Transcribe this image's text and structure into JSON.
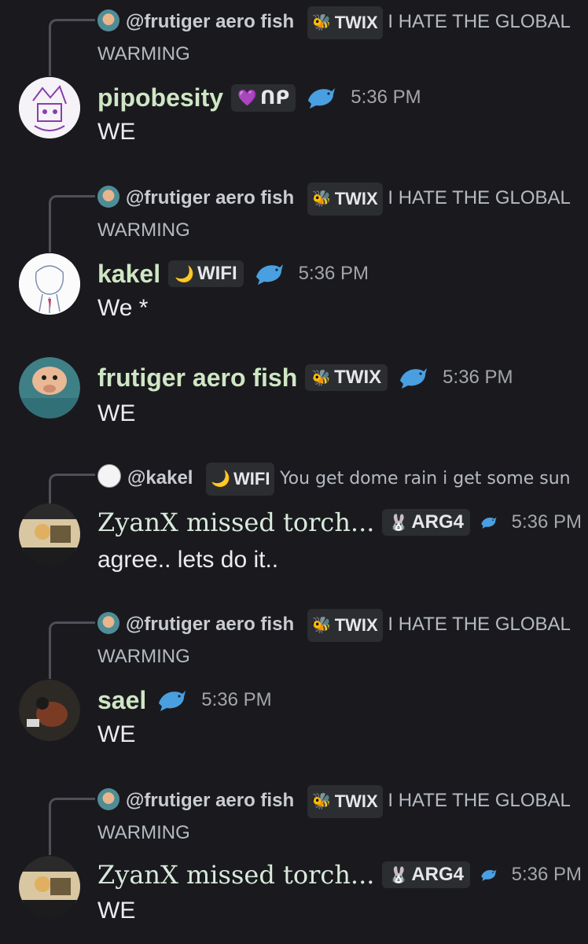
{
  "messages": [
    {
      "reply": {
        "name": "@frutiger aero fish",
        "tag": "TWIX",
        "tag_icon": "bee",
        "text": "I HATE THE GLOBAL WARMING"
      },
      "author": "pipobesity",
      "tag": "ᑎᑭ",
      "tag_icon": "purple-heart",
      "time": "5:36 PM",
      "content": "WE"
    },
    {
      "reply": {
        "name": "@frutiger aero fish",
        "tag": "TWIX",
        "tag_icon": "bee",
        "text": "I HATE THE GLOBAL WARMING"
      },
      "author": "kakel",
      "tag": "WIFI",
      "tag_icon": "purple-moon",
      "time": "5:36 PM",
      "content": "We *"
    },
    {
      "author": "frutiger aero fish",
      "tag": "TWIX",
      "tag_icon": "bee",
      "time": "5:36 PM",
      "content": "WE"
    },
    {
      "reply": {
        "name": "@kakel",
        "tag": "WIFI",
        "tag_icon": "purple-moon",
        "text": "You get dome rain i get some sun"
      },
      "author": "ZyanX missed torch...",
      "tag": "ARG4",
      "tag_icon": "bunny",
      "time": "5:36 PM",
      "content": "agree.. lets do it.."
    },
    {
      "reply": {
        "name": "@frutiger aero fish",
        "tag": "TWIX",
        "tag_icon": "bee",
        "text": "I HATE THE GLOBAL WARMING"
      },
      "author": "sael",
      "time": "5:36 PM",
      "content": "WE"
    },
    {
      "reply": {
        "name": "@frutiger aero fish",
        "tag": "TWIX",
        "tag_icon": "bee",
        "text": "I HATE THE GLOBAL WARMING"
      },
      "author": "ZyanX missed torch...",
      "tag": "ARG4",
      "tag_icon": "bunny",
      "time": "5:36 PM",
      "content": "WE"
    }
  ],
  "icons": {
    "bee": "🐝",
    "purple-heart": "💜",
    "purple-moon": "🌙",
    "bunny": "🐰",
    "dolphin": "dolphin-icon"
  },
  "colors": {
    "background": "#1a1a1e",
    "username": "#cfe6c4",
    "tag_bg": "#2b2d31",
    "dolphin": "#4a9fe0"
  }
}
